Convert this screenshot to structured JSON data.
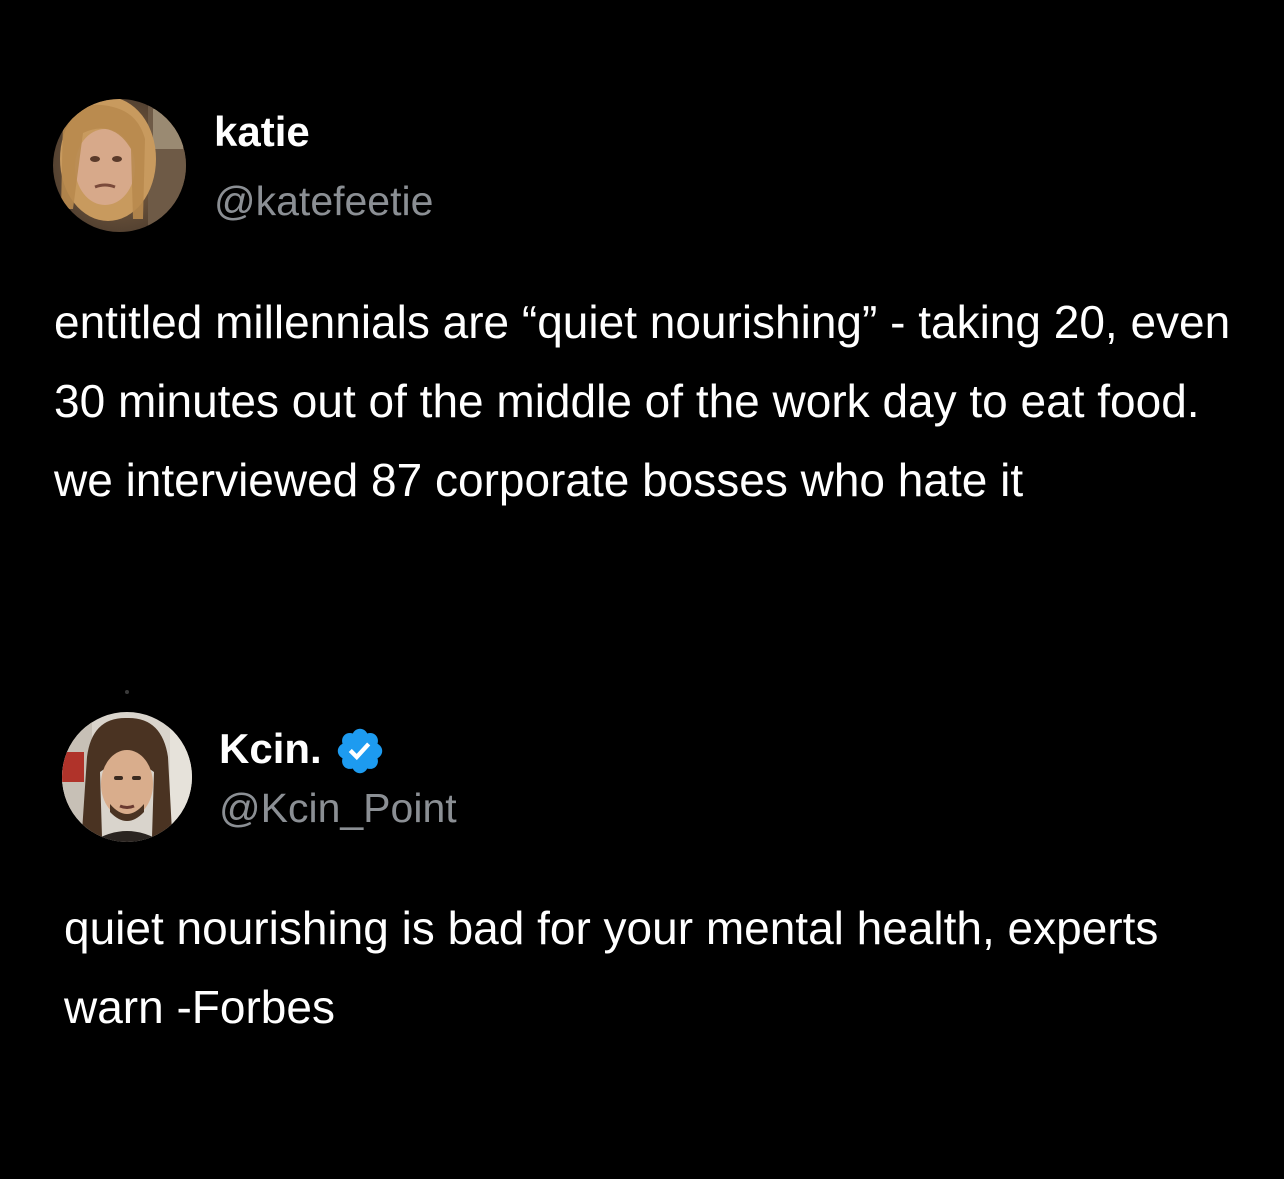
{
  "tweets": [
    {
      "display_name": "katie",
      "handle": "@katefeetie",
      "verified": false,
      "avatar_icon": "profile-photo-icon",
      "text": "entitled millennials are “quiet nourishing” - taking 20, even 30 minutes out of the middle of the work day to eat food. we interviewed 87 corporate bosses who hate it"
    },
    {
      "display_name": "Kcin.",
      "handle": "@Kcin_Point",
      "verified": true,
      "verified_icon": "verified-badge-icon",
      "avatar_icon": "profile-photo-icon",
      "text": "quiet nourishing is bad for your mental health, experts warn -Forbes"
    }
  ],
  "colors": {
    "background": "#000000",
    "text": "#ffffff",
    "handle": "#8b8f94",
    "verified": "#1d9bf0"
  }
}
